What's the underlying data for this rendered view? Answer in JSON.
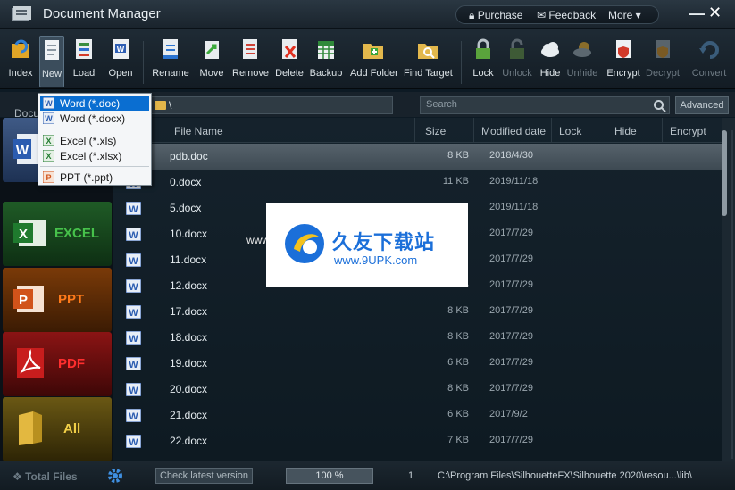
{
  "app": {
    "title": "Document Manager"
  },
  "topbar": {
    "purchase": "Purchase",
    "feedback": "Feedback",
    "more": "More ▾",
    "minimize": "—",
    "close": "✕"
  },
  "toolbar": [
    {
      "label": "Index",
      "icon": "index-icon",
      "enabled": true
    },
    {
      "label": "New",
      "icon": "new-icon",
      "enabled": true
    },
    {
      "label": "Load",
      "icon": "load-icon",
      "enabled": true
    },
    {
      "label": "Open",
      "icon": "open-icon",
      "enabled": true
    },
    {
      "label": "Rename",
      "icon": "rename-icon",
      "enabled": true
    },
    {
      "label": "Move",
      "icon": "move-icon",
      "enabled": true
    },
    {
      "label": "Remove",
      "icon": "remove-icon",
      "enabled": true
    },
    {
      "label": "Delete",
      "icon": "delete-icon",
      "enabled": true
    },
    {
      "label": "Backup",
      "icon": "backup-icon",
      "enabled": true
    },
    {
      "label": "Add Folder",
      "icon": "add-folder-icon",
      "enabled": true
    },
    {
      "label": "Find Target",
      "icon": "find-target-icon",
      "enabled": true
    },
    {
      "label": "Lock",
      "icon": "lock-icon",
      "enabled": true
    },
    {
      "label": "Unlock",
      "icon": "unlock-icon",
      "enabled": false
    },
    {
      "label": "Hide",
      "icon": "hide-icon",
      "enabled": true
    },
    {
      "label": "Unhide",
      "icon": "unhide-icon",
      "enabled": false
    },
    {
      "label": "Encrypt",
      "icon": "encrypt-icon",
      "enabled": true
    },
    {
      "label": "Decrypt",
      "icon": "decrypt-icon",
      "enabled": false
    },
    {
      "label": "Convert",
      "icon": "convert-icon",
      "enabled": false
    }
  ],
  "new_menu": [
    {
      "label": "Word (*.doc)",
      "icon": "word-icon",
      "highlighted": true
    },
    {
      "label": "Word (*.docx)",
      "icon": "word-icon",
      "highlighted": false
    },
    {
      "label": "Excel (*.xls)",
      "icon": "excel-icon",
      "highlighted": false
    },
    {
      "label": "Excel (*.xlsx)",
      "icon": "excel-icon",
      "highlighted": false
    },
    {
      "label": "PPT (*.ppt)",
      "icon": "ppt-icon",
      "highlighted": false
    }
  ],
  "address": {
    "category_caption": "Docu",
    "path": "\\",
    "search_placeholder": "Search",
    "advanced": "Advanced"
  },
  "sidebar": [
    {
      "label": "",
      "icon": "word-icon"
    },
    {
      "label": "EXCEL",
      "icon": "excel-icon"
    },
    {
      "label": "PPT",
      "icon": "ppt-icon"
    },
    {
      "label": "PDF",
      "icon": "pdf-icon"
    },
    {
      "label": "All",
      "icon": "folder-icon"
    }
  ],
  "columns": [
    "File Name",
    "Size",
    "Modified date",
    "Lock",
    "Hide",
    "Encrypt"
  ],
  "files": [
    {
      "name": "pdb.doc",
      "size": "8 KB",
      "date": "2018/4/30",
      "selected": true
    },
    {
      "name": "0.docx",
      "size": "11 KB",
      "date": "2019/11/18",
      "selected": false
    },
    {
      "name": "5.docx",
      "size": "",
      "date": "2019/11/18",
      "selected": false
    },
    {
      "name": "10.docx",
      "size": "",
      "date": "2017/7/29",
      "selected": false
    },
    {
      "name": "11.docx",
      "size": "",
      "date": "2017/7/29",
      "selected": false
    },
    {
      "name": "12.docx",
      "size": "8 KB",
      "date": "2017/7/29",
      "selected": false
    },
    {
      "name": "17.docx",
      "size": "8 KB",
      "date": "2017/7/29",
      "selected": false
    },
    {
      "name": "18.docx",
      "size": "8 KB",
      "date": "2017/7/29",
      "selected": false
    },
    {
      "name": "19.docx",
      "size": "6 KB",
      "date": "2017/7/29",
      "selected": false
    },
    {
      "name": "20.docx",
      "size": "8 KB",
      "date": "2017/7/29",
      "selected": false
    },
    {
      "name": "21.docx",
      "size": "6 KB",
      "date": "2017/9/2",
      "selected": false
    },
    {
      "name": "22.docx",
      "size": "7 KB",
      "date": "2017/7/29",
      "selected": false
    }
  ],
  "watermark": {
    "cn": "久友下载站",
    "url": "www.9UPK.com",
    "side": "www.9U"
  },
  "status": {
    "total_files": "Total Files",
    "check_version": "Check latest version",
    "zoom": "100 %",
    "count": "1",
    "path": "C:\\Program Files\\SilhouetteFX\\Silhouette 2020\\resou...\\lib\\"
  },
  "colors": {
    "accent": "#0a6ed1",
    "selected_row": "#56626b",
    "background": "#0d1a24"
  }
}
